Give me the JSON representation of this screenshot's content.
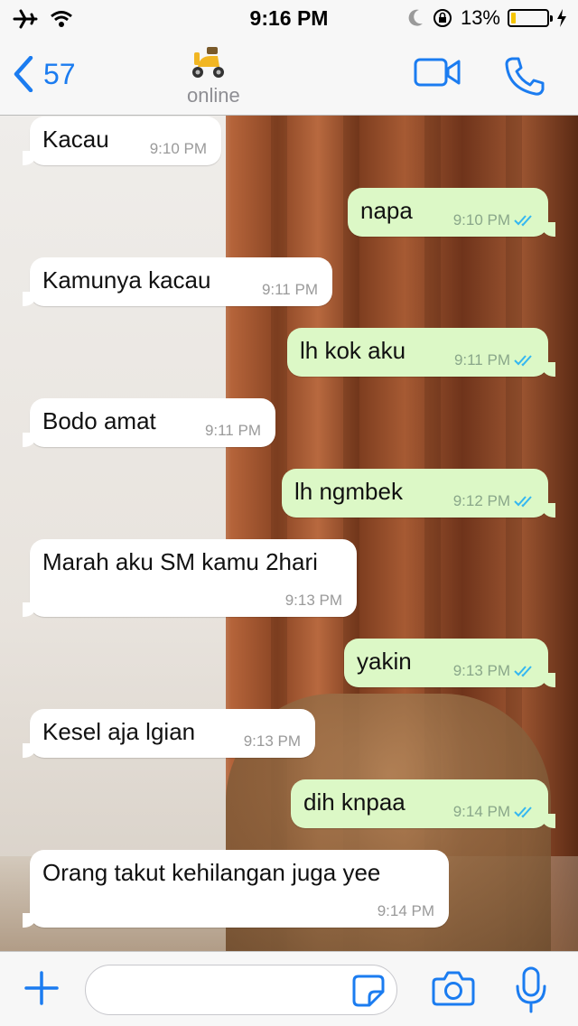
{
  "status_bar": {
    "time": "9:16 PM",
    "battery_percent": "13%",
    "battery_level": 0.13
  },
  "header": {
    "back_count": "57",
    "contact_status": "online",
    "avatar_icon": "scooter-icon",
    "actions": [
      "video-call-icon",
      "phone-icon"
    ]
  },
  "messages": [
    {
      "dir": "in",
      "text": "Kacau",
      "time": "9:10 PM"
    },
    {
      "dir": "out",
      "text": "napa",
      "time": "9:10 PM"
    },
    {
      "dir": "in",
      "text": "Kamunya kacau",
      "time": "9:11 PM"
    },
    {
      "dir": "out",
      "text": "lh kok aku",
      "time": "9:11 PM"
    },
    {
      "dir": "in",
      "text": "Bodo amat",
      "time": "9:11 PM"
    },
    {
      "dir": "out",
      "text": "lh ngmbek",
      "time": "9:12 PM"
    },
    {
      "dir": "in",
      "text": "Marah aku SM kamu 2hari",
      "time": "9:13 PM"
    },
    {
      "dir": "out",
      "text": "yakin",
      "time": "9:13 PM"
    },
    {
      "dir": "in",
      "text": "Kesel aja lgian",
      "time": "9:13 PM"
    },
    {
      "dir": "out",
      "text": "dih knpaa",
      "time": "9:14 PM"
    },
    {
      "dir": "in",
      "text": "Orang takut kehilangan juga yee",
      "time": "9:14 PM"
    }
  ],
  "input_bar": {
    "message_value": "",
    "icons": [
      "plus-icon",
      "sticker-icon",
      "camera-icon",
      "microphone-icon"
    ]
  },
  "colors": {
    "accent": "#1b7cf0",
    "incoming_bubble": "#ffffff",
    "outgoing_bubble": "#dcf8c6",
    "read_ticks": "#34b7f1"
  }
}
